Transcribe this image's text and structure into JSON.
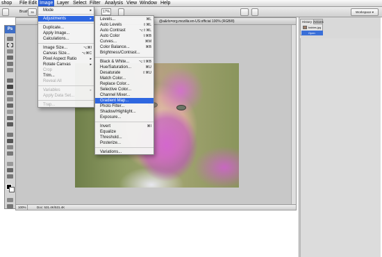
{
  "menubar": {
    "items": [
      "Photoshop",
      "File",
      "Edit",
      "Image",
      "Layer",
      "Select",
      "Filter",
      "Analysis",
      "View",
      "Window",
      "Help"
    ],
    "visible_items": [
      "shop",
      "File",
      "Edit",
      "Image",
      "Layer",
      "Select",
      "Filter",
      "Analysis",
      "View",
      "Window",
      "Help"
    ],
    "active": "Image"
  },
  "options_bar": {
    "brush_label": "Brush:",
    "brush_size": "35",
    "opacity_value": "100%",
    "flow_value": "17%",
    "workspace_label": "Workspace ▾"
  },
  "tools": {
    "logo": "Ps"
  },
  "document": {
    "title": "@a&rls=org.mozilla:en-US:official",
    "title_suffix": "100% (RGB/8)",
    "zoom": "100%",
    "doc_size": "Doc: 531.4K/531.4K"
  },
  "image_menu": {
    "items": [
      {
        "label": "Mode",
        "arrow": "▸",
        "disabled": false
      },
      {
        "label": "Adjustments",
        "arrow": "▸",
        "disabled": false,
        "highlighted": true
      },
      {
        "label": "Duplicate...",
        "disabled": false
      },
      {
        "label": "Apply Image...",
        "disabled": false
      },
      {
        "label": "Calculations...",
        "disabled": false
      },
      {
        "label": "Image Size...",
        "shortcut": "⌥⌘I",
        "disabled": false
      },
      {
        "label": "Canvas Size...",
        "shortcut": "⌥⌘C",
        "disabled": false
      },
      {
        "label": "Pixel Aspect Ratio",
        "arrow": "▸",
        "disabled": false
      },
      {
        "label": "Rotate Canvas",
        "arrow": "▸",
        "disabled": false
      },
      {
        "label": "Crop",
        "disabled": true
      },
      {
        "label": "Trim...",
        "disabled": false
      },
      {
        "label": "Reveal All",
        "disabled": true
      },
      {
        "label": "Variables",
        "arrow": "▸",
        "disabled": true
      },
      {
        "label": "Apply Data Set...",
        "disabled": true
      },
      {
        "label": "Trap...",
        "disabled": true
      }
    ]
  },
  "adjustments_menu": {
    "items": [
      {
        "label": "Levels...",
        "shortcut": "⌘L"
      },
      {
        "label": "Auto Levels",
        "shortcut": "⇧⌘L"
      },
      {
        "label": "Auto Contrast",
        "shortcut": "⌥⇧⌘L"
      },
      {
        "label": "Auto Color",
        "shortcut": "⇧⌘B"
      },
      {
        "label": "Curves...",
        "shortcut": "⌘M"
      },
      {
        "label": "Color Balance...",
        "shortcut": "⌘B"
      },
      {
        "label": "Brightness/Contrast...",
        "shortcut": ""
      },
      {
        "label": "Black & White...",
        "shortcut": "⌥⇧⌘B"
      },
      {
        "label": "Hue/Saturation...",
        "shortcut": "⌘U"
      },
      {
        "label": "Desaturate",
        "shortcut": "⇧⌘U"
      },
      {
        "label": "Match Color...",
        "shortcut": ""
      },
      {
        "label": "Replace Color...",
        "shortcut": ""
      },
      {
        "label": "Selective Color...",
        "shortcut": ""
      },
      {
        "label": "Channel Mixer...",
        "shortcut": ""
      },
      {
        "label": "Gradient Map...",
        "shortcut": "",
        "highlighted": true
      },
      {
        "label": "Photo Filter...",
        "shortcut": ""
      },
      {
        "label": "Shadow/Highlight...",
        "shortcut": ""
      },
      {
        "label": "Exposure...",
        "shortcut": ""
      },
      {
        "label": "Invert",
        "shortcut": "⌘I"
      },
      {
        "label": "Equalize",
        "shortcut": ""
      },
      {
        "label": "Threshold...",
        "shortcut": ""
      },
      {
        "label": "Posterize...",
        "shortcut": ""
      },
      {
        "label": "Variations...",
        "shortcut": ""
      }
    ]
  },
  "history_panel": {
    "tabs": [
      "History",
      "Actions"
    ],
    "snapshot": "babies.jpg",
    "open_state": "Open"
  }
}
